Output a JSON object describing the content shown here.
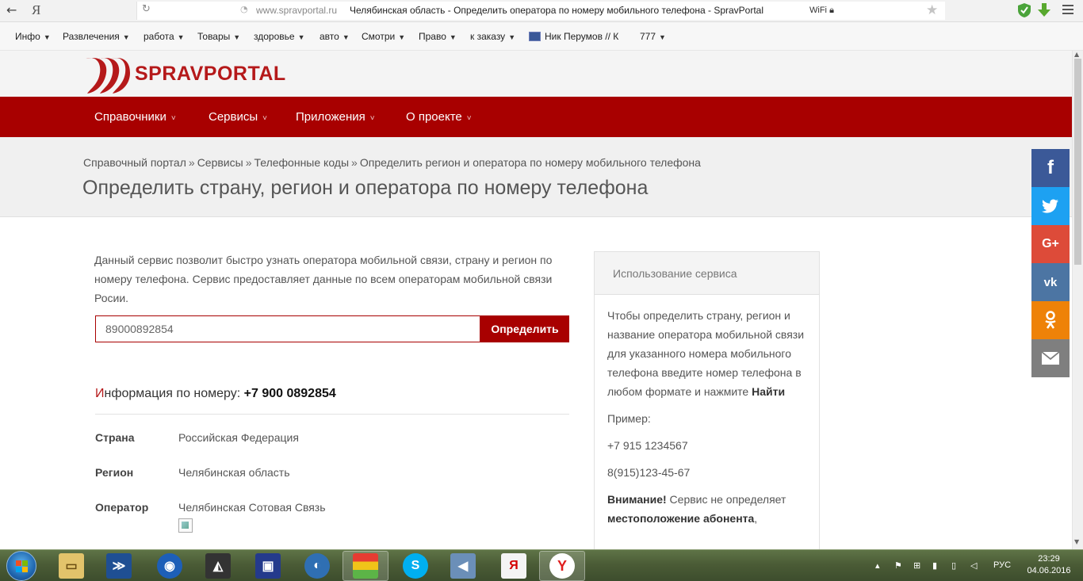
{
  "browser": {
    "back": "←",
    "yandex_logo": "Я",
    "reload": "↻",
    "url": "www.spravportal.ru",
    "title": "Челябинская область - Определить оператора по номеру мобильного телефона - SpravPortal",
    "wifi": "WiFi",
    "star": "★"
  },
  "bookmarks": [
    {
      "label": "Инфо"
    },
    {
      "label": "Развлечения"
    },
    {
      "label": "работа"
    },
    {
      "label": "Товары"
    },
    {
      "label": "здоровье"
    },
    {
      "label": "авто"
    },
    {
      "label": "Смотри"
    },
    {
      "label": "Право"
    },
    {
      "label": "к заказу"
    },
    {
      "label": "Ник Перумов // К"
    },
    {
      "label": "777"
    }
  ],
  "site": {
    "logo_spr": "SPRAV",
    "logo_portal": "PORTAL"
  },
  "nav": [
    {
      "label": "Справочники"
    },
    {
      "label": "Сервисы"
    },
    {
      "label": "Приложения"
    },
    {
      "label": "О проекте"
    }
  ],
  "breadcrumb": [
    "Справочный портал",
    "Сервисы",
    "Телефонные коды",
    "Определить регион и оператора по номеру мобильного телефона"
  ],
  "breadcrumb_sep": "»",
  "page_title": "Определить страну, регион и оператора по номеру телефона",
  "intro": "Данный сервис позволит быстро узнать оператора мобильной связи, страну и регион по номеру телефона. Сервис предоставляет данные по всем операторам мобильной связи Росии.",
  "search": {
    "value": "89000892854",
    "button": "Определить"
  },
  "result": {
    "heading_first": "И",
    "heading_rest": "нформация по номеру: ",
    "number": "+7 900 0892854",
    "rows": [
      {
        "label": "Страна",
        "value": "Российская Федерация"
      },
      {
        "label": "Регион",
        "value": "Челябинская область"
      },
      {
        "label": "Оператор",
        "value": "Челябинская Сотовая Связь"
      }
    ]
  },
  "sidebar": {
    "title": "Использование сервиса",
    "text1": "Чтобы определить страну, регион и название оператора мобильной связи для указанного номера мобильного телефона введите номер телефона в любом формате и нажмите ",
    "text1_bold": "Найти",
    "example_label": "Пример:",
    "example1": "+7 915 1234567",
    "example2": "8(915)123-45-67",
    "warn_bold": "Внимание!",
    "warn_text": " Сервис не определяет ",
    "warn_bold2": "местоположение абонента",
    "warn_tail": ","
  },
  "social": {
    "fb": "f",
    "gp": "G+",
    "vk": "vk",
    "ok": "ok"
  },
  "taskbar": {
    "lang": "РУС",
    "time": "23:29",
    "date": "04.06.2016"
  },
  "colors": {
    "brand_red": "#a80000",
    "facebook": "#3b5998",
    "twitter": "#1da1f2",
    "googleplus": "#dd4b39",
    "vk": "#4c75a3",
    "ok": "#ee8208",
    "mail": "#7f7f7f"
  }
}
